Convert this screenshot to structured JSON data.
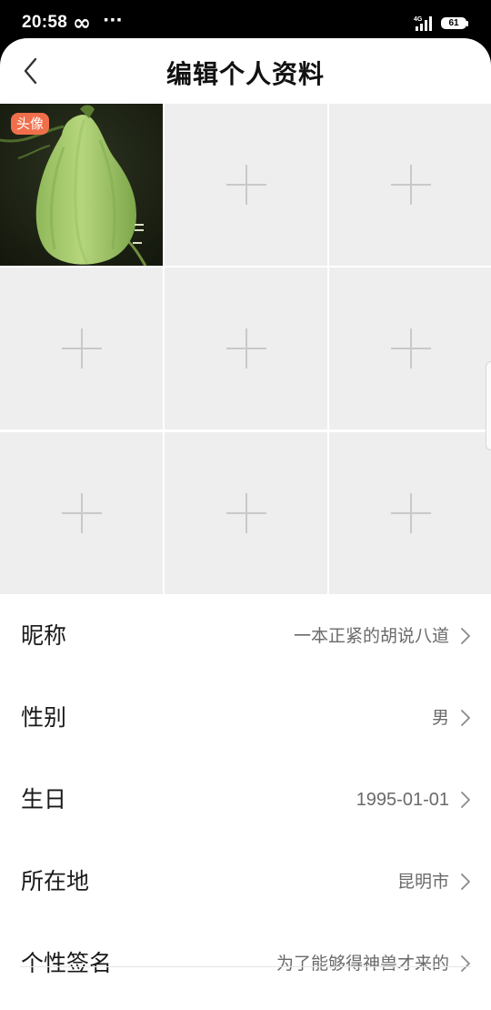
{
  "status_bar": {
    "time": "20:58",
    "infinity": "∞",
    "more": "···",
    "network": "4G",
    "battery": "61"
  },
  "header": {
    "title": "编辑个人资料",
    "back_icon": "chevron-left-icon"
  },
  "photo_grid": {
    "avatar_badge": "头像",
    "add_icon": "plus-icon",
    "empty_slots": 8
  },
  "profile_fields": [
    {
      "label": "昵称",
      "value": "一本正紧的胡说八道"
    },
    {
      "label": "性别",
      "value": "男"
    },
    {
      "label": "生日",
      "value": "1995-01-01"
    },
    {
      "label": "所在地",
      "value": "昆明市"
    },
    {
      "label": "个性签名",
      "value": "为了能够得神兽才来的"
    }
  ],
  "colors": {
    "badge": "#f06e4a",
    "cell_bg": "#eeeeee",
    "plus": "#c9c9c9"
  }
}
